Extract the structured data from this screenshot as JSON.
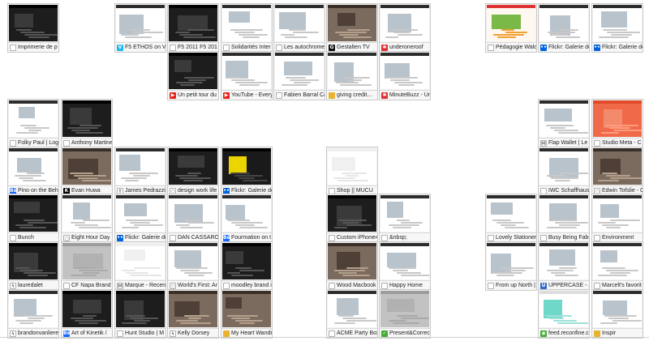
{
  "tiles": [
    {
      "label": "Imprimerie de p",
      "favicon": "page-icon",
      "theme": "dark"
    },
    {
      "label": "F5 ETHOS on Vi",
      "favicon": "vimeo-icon",
      "theme": "light"
    },
    {
      "label": "F5 2011 F5 201",
      "favicon": "page-icon",
      "theme": "dark"
    },
    {
      "label": "Solidarités Inter",
      "favicon": "page-icon",
      "theme": "light"
    },
    {
      "label": "Les autochrome",
      "favicon": "page-icon",
      "theme": "light"
    },
    {
      "label": "Gestalten TV",
      "favicon": "gestalten-icon",
      "theme": "photo"
    },
    {
      "label": "underoneroof",
      "favicon": "red-icon",
      "theme": "light"
    },
    {
      "label": "Pédagogie Wald",
      "favicon": "page-icon",
      "theme": "colorful"
    },
    {
      "label": "Flickr: Galerie de",
      "favicon": "flickr-icon",
      "theme": "light"
    },
    {
      "label": "Flickr: Galerie de",
      "favicon": "flickr-icon",
      "theme": "light"
    },
    {
      "label": "Un petit tour du",
      "favicon": "youtube-icon",
      "theme": "dark"
    },
    {
      "label": "YouTube - Every",
      "favicon": "youtube-icon",
      "theme": "light"
    },
    {
      "label": "Fabien Barral C&",
      "favicon": "page-icon",
      "theme": "light"
    },
    {
      "label": "giving credit...",
      "favicon": "folder-icon",
      "theme": "light"
    },
    {
      "label": "MinuteBuzz - Ur",
      "favicon": "red-icon",
      "theme": "light"
    },
    {
      "label": "Folky Paul | Log",
      "favicon": "page-icon",
      "theme": "light"
    },
    {
      "label": "Anthony Martine",
      "favicon": "page-icon",
      "theme": "dark"
    },
    {
      "label": "Flap Wallet | Le",
      "favicon": "m-icon",
      "theme": "light"
    },
    {
      "label": "Studio Meta - C",
      "favicon": "page-icon",
      "theme": "orange"
    },
    {
      "label": "Pino on the Beh",
      "favicon": "behance-icon",
      "theme": "light"
    },
    {
      "label": "Evan Huwa",
      "favicon": "k-icon",
      "theme": "photo"
    },
    {
      "label": "James Pedrazzin",
      "favicon": "tag-icon",
      "theme": "light"
    },
    {
      "label": "design work life",
      "favicon": "circle-icon",
      "theme": "dark"
    },
    {
      "label": "Flickr: Galerie de",
      "favicon": "flickr-icon",
      "theme": "yellow"
    },
    {
      "label": "Shop || MUCU",
      "favicon": "page-icon",
      "theme": "white"
    },
    {
      "label": "IWC Schaffhause",
      "favicon": "page-icon",
      "theme": "light"
    },
    {
      "label": "Edwin Tofslie - C",
      "favicon": "circle-icon",
      "theme": "photo"
    },
    {
      "label": "Bunch",
      "favicon": "page-icon",
      "theme": "dark"
    },
    {
      "label": "Eight Hour Day",
      "favicon": "circle-icon",
      "theme": "light"
    },
    {
      "label": "Flickr: Galerie de",
      "favicon": "flickr-icon",
      "theme": "light"
    },
    {
      "label": "DAN CASSARO -",
      "favicon": "page-icon",
      "theme": "light"
    },
    {
      "label": "Fourmation on t",
      "favicon": "behance-icon",
      "theme": "light"
    },
    {
      "label": "Custom iPhone4",
      "favicon": "page-icon",
      "theme": "dark"
    },
    {
      "label": "&nbsp;",
      "favicon": "page-icon",
      "theme": "light"
    },
    {
      "label": "Lovely Stationer",
      "favicon": "page-icon",
      "theme": "light"
    },
    {
      "label": "Busy Being Fabu",
      "favicon": "page-icon",
      "theme": "light"
    },
    {
      "label": "Environment",
      "favicon": "page-icon",
      "theme": "light"
    },
    {
      "label": "lauredalet",
      "favicon": "bolt-icon",
      "theme": "dark"
    },
    {
      "label": "CF Napa Brand",
      "favicon": "page-icon",
      "theme": "grey"
    },
    {
      "label": "Marque - Recent",
      "favicon": "m-icon",
      "theme": "white"
    },
    {
      "label": "World's First: Ar",
      "favicon": "circle-icon",
      "theme": "light"
    },
    {
      "label": "moodley brand i",
      "favicon": "page-icon",
      "theme": "dark"
    },
    {
      "label": "Wood Macbook",
      "favicon": "page-icon",
      "theme": "photo"
    },
    {
      "label": "Happy Home",
      "favicon": "page-icon",
      "theme": "light"
    },
    {
      "label": "From up North |",
      "favicon": "page-icon",
      "theme": "light"
    },
    {
      "label": "UPPERCASE - Jo",
      "favicon": "u-icon",
      "theme": "light"
    },
    {
      "label": "Marcelt's favorit",
      "favicon": "page-icon",
      "theme": "light"
    },
    {
      "label": "brandonvanliere",
      "favicon": "bolt-icon",
      "theme": "light"
    },
    {
      "label": "Art of Kinetik /",
      "favicon": "behance-icon",
      "theme": "dark"
    },
    {
      "label": "Hunt Studio | M",
      "favicon": "page-icon",
      "theme": "dark"
    },
    {
      "label": "Kelly Dorsey",
      "favicon": "bolt-icon",
      "theme": "photo"
    },
    {
      "label": "My Heart Wandr",
      "favicon": "folder-icon",
      "theme": "photo"
    },
    {
      "label": "ACME Party Box",
      "favicon": "page-icon",
      "theme": "light"
    },
    {
      "label": "Present&Correct",
      "favicon": "check-icon",
      "theme": "grey"
    },
    {
      "label": "feed.reconfine.c",
      "favicon": "feed-icon",
      "theme": "cyan"
    },
    {
      "label": "Inspir",
      "favicon": "folder-icon",
      "theme": "light"
    }
  ],
  "colors": {
    "flickr": "#0063dc",
    "behance": "#1769ff",
    "youtube": "#e62117",
    "vimeo": "#1ab7ea",
    "red": "#e03030",
    "green": "#44aa33",
    "folder": "#e8b32e"
  }
}
